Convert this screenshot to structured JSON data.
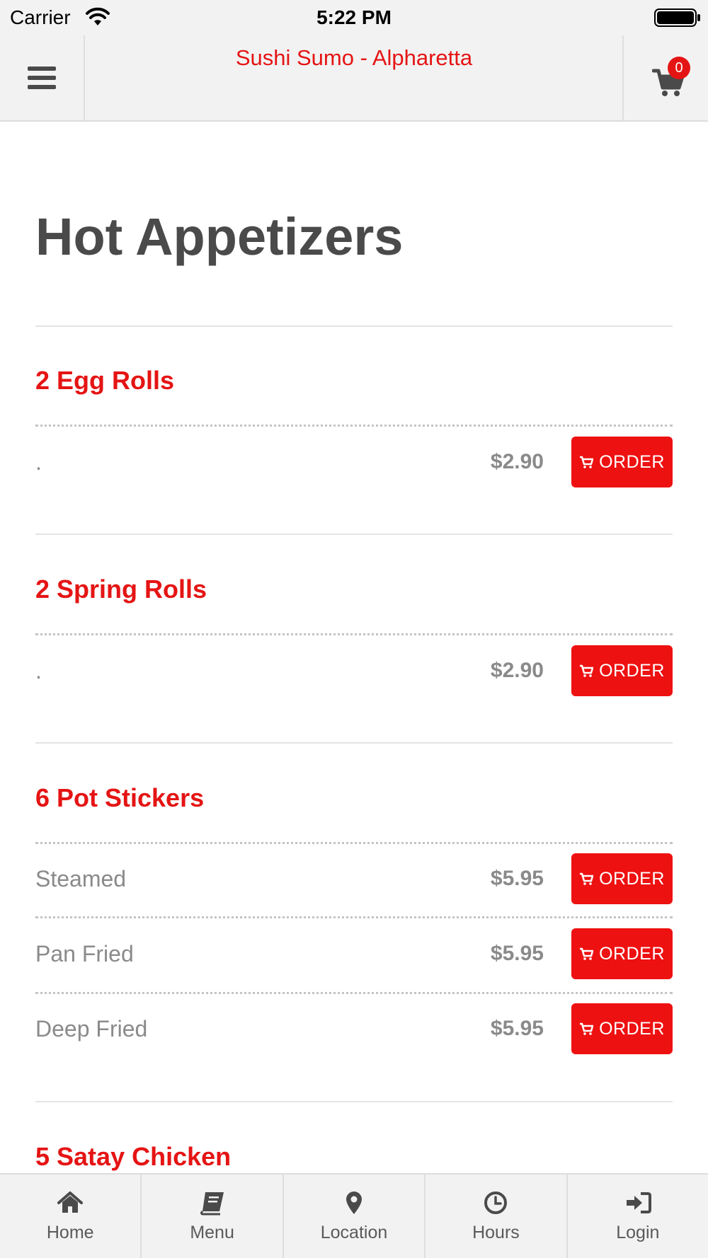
{
  "status_bar": {
    "carrier": "Carrier",
    "time": "5:22 PM"
  },
  "header": {
    "title": "Sushi Sumo - Alpharetta",
    "cart_count": "0"
  },
  "page": {
    "title": "Hot Appetizers"
  },
  "order_label": "ORDER",
  "items": [
    {
      "name": "2 Egg Rolls",
      "options": [
        {
          "label": ".",
          "price": "$2.90"
        }
      ]
    },
    {
      "name": "2 Spring Rolls",
      "options": [
        {
          "label": ".",
          "price": "$2.90"
        }
      ]
    },
    {
      "name": "6 Pot Stickers",
      "options": [
        {
          "label": "Steamed",
          "price": "$5.95"
        },
        {
          "label": "Pan Fried",
          "price": "$5.95"
        },
        {
          "label": "Deep Fried",
          "price": "$5.95"
        }
      ]
    },
    {
      "name": "5 Satay Chicken"
    }
  ],
  "tabs": [
    {
      "label": "Home",
      "icon": "home-icon"
    },
    {
      "label": "Menu",
      "icon": "book-icon"
    },
    {
      "label": "Location",
      "icon": "map-marker-icon"
    },
    {
      "label": "Hours",
      "icon": "clock-icon"
    },
    {
      "label": "Login",
      "icon": "sign-in-icon"
    }
  ],
  "colors": {
    "accent": "#e51414",
    "button": "#ee1111",
    "heading": "#4a4a4a",
    "muted": "#8a8a8a",
    "bar": "#f2f2f2"
  }
}
